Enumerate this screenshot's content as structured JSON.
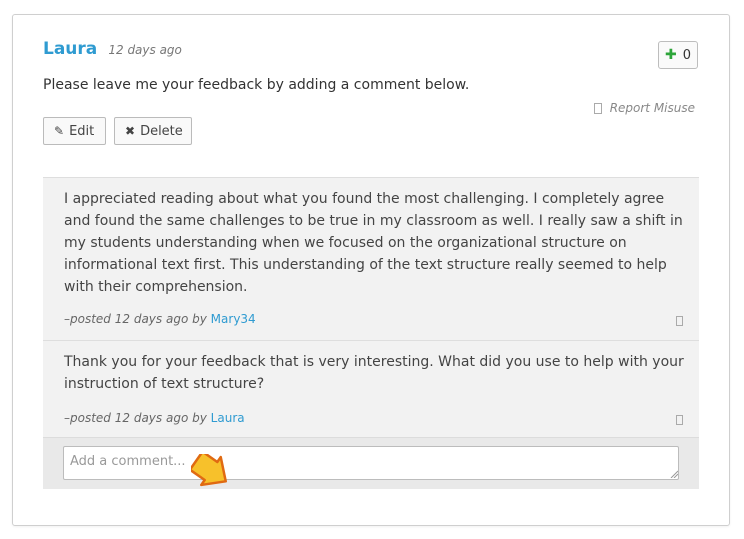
{
  "post": {
    "author": "Laura",
    "time": "12 days ago",
    "text": "Please leave me your feedback by adding a comment below.",
    "vote_count": "0",
    "report_label": "Report Misuse",
    "edit_label": "Edit",
    "delete_label": "Delete"
  },
  "comments": [
    {
      "text": "I appreciated reading about what you found the most challenging. I completely agree and found the same challenges to be true in my classroom as well. I really saw a shift in my students understanding when we focused on the organizational structure on informational text first. This understanding of the text structure really seemed to help with their comprehension.",
      "posted_prefix": "–posted",
      "time": "12 days ago",
      "by": "by",
      "user": "Mary34"
    },
    {
      "text": "Thank you for your feedback that is very interesting. What did you use to help with your instruction of text structure?",
      "posted_prefix": "–posted",
      "time": "12 days ago",
      "by": "by",
      "user": "Laura"
    }
  ],
  "add_comment": {
    "placeholder": "Add a comment..."
  },
  "icons": {
    "vote": "plus-icon",
    "edit": "pencil-icon",
    "delete": "x-icon",
    "report": "flag-icon",
    "cursor": "pointing-arrow-icon"
  },
  "colors": {
    "accent": "#2f9bd1",
    "vote_plus": "#2ea53a",
    "comment_bg": "#f2f2f2"
  }
}
